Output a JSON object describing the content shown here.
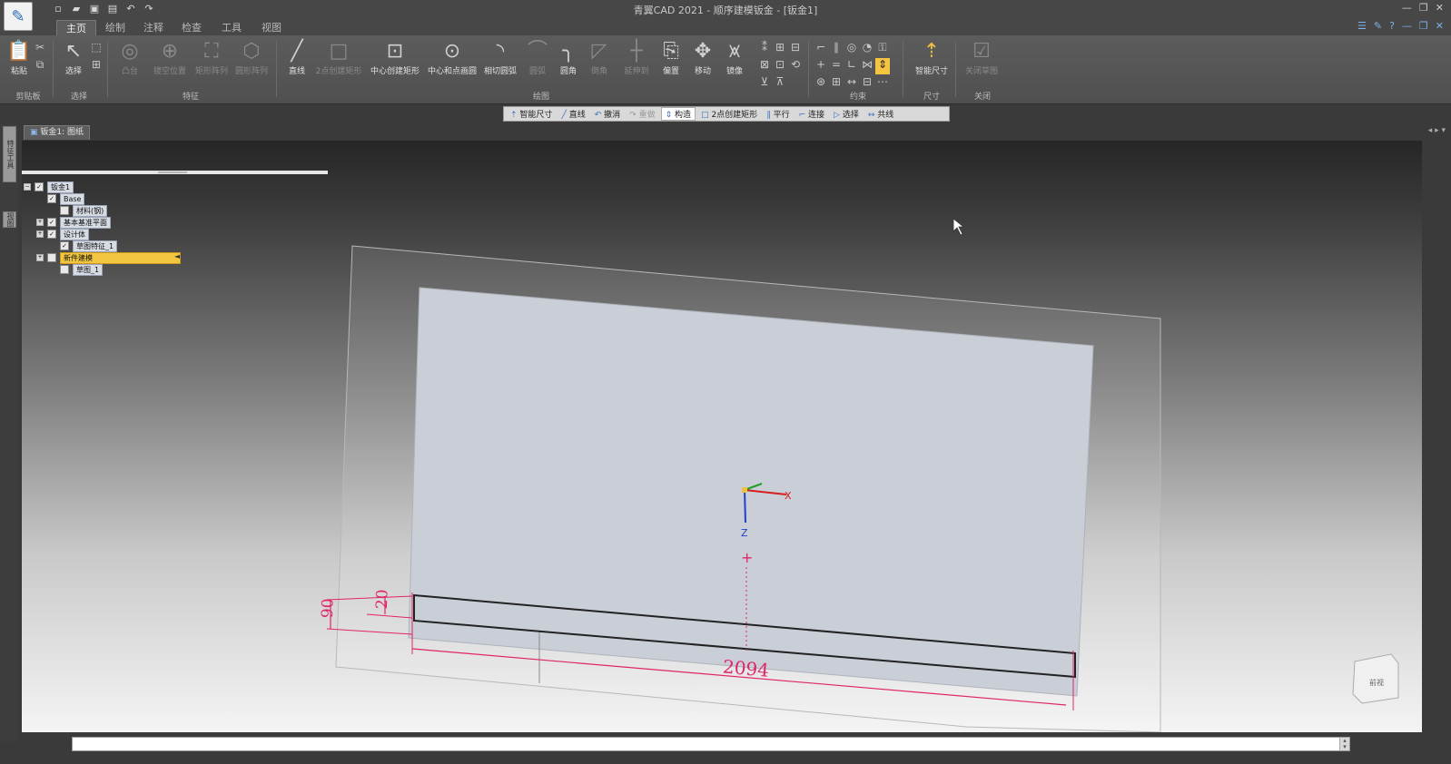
{
  "window": {
    "title": "青翼CAD 2021 - 顺序建模钣金 - [钣金1]",
    "logo_icon": "app-feather-logo"
  },
  "quick_access": [
    {
      "name": "new-icon",
      "glyph": "▫"
    },
    {
      "name": "open-icon",
      "glyph": "▰"
    },
    {
      "name": "save-icon",
      "glyph": "▣"
    },
    {
      "name": "print-icon",
      "glyph": "▤"
    },
    {
      "name": "undo-icon",
      "glyph": "↶"
    },
    {
      "name": "redo-icon",
      "glyph": "↷"
    }
  ],
  "ribbon_tabs": [
    "主页",
    "绘制",
    "注释",
    "检查",
    "工具",
    "视图"
  ],
  "active_tab": 0,
  "ribbon": {
    "paste": "粘贴",
    "select": "选择",
    "clipboard_group": "剪贴板",
    "select_group": "选择",
    "feature_group": "特征",
    "draw_group": "绘图",
    "constraint_group": "约束",
    "dimension_group": "尺寸",
    "close_group": "关闭",
    "feature_buttons": [
      "凸台",
      "镂空位置",
      "矩形阵列",
      "圆形阵列"
    ],
    "line": "直线",
    "rect_2pt": "2点创建矩形",
    "rect_center": "中心创建矩形",
    "circle_center": "中心和点画圆",
    "arc_tangent": "相切圆弧",
    "arc_3pt": "圆弧",
    "fillet": "圆角",
    "chamfer": "倒角",
    "trim_extend": "延伸到",
    "offset": "偏置",
    "move": "移动",
    "mirror": "镜像",
    "smart_dimension": "智能尺寸",
    "close_sketch": "关闭草图"
  },
  "command_bar": {
    "smart_dim": "智能尺寸",
    "line": "直线",
    "undo": "撤消",
    "redo": "重做",
    "construct": "构造",
    "rect2": "2点创建矩形",
    "parallel": "平行",
    "connect": "连接",
    "select": "选择",
    "collinear": "共线"
  },
  "document_tab": "钣金1: 图纸",
  "left_strip": [
    "特征工具",
    "视图"
  ],
  "tree": [
    {
      "label": "钣金1",
      "level": 0,
      "checked": true,
      "expander": "−"
    },
    {
      "label": "Base",
      "level": 1,
      "checked": true,
      "expander": ""
    },
    {
      "label": "材料(钢)",
      "level": 2,
      "checked": false,
      "expander": ""
    },
    {
      "label": "基本基准平面",
      "level": 1,
      "checked": true,
      "expander": "+"
    },
    {
      "label": "设计体",
      "level": 1,
      "checked": true,
      "expander": "+"
    },
    {
      "label": "草图特征_1",
      "level": 2,
      "checked": true,
      "expander": ""
    },
    {
      "label": "新件建模",
      "level": 1,
      "checked": false,
      "expander": "+",
      "selected": true,
      "suffix": "◄"
    },
    {
      "label": "草图_1",
      "level": 2,
      "checked": false,
      "expander": ""
    }
  ],
  "dimensions": {
    "overall_width": "2094",
    "height_outer": "90",
    "height_inner": "20"
  },
  "axes": {
    "x_label": "X",
    "z_label": "Z"
  },
  "view_cube_label": "前视",
  "colors": {
    "dimension": "#e0246a",
    "sketch_line": "#222222",
    "axis_x": "#d42020",
    "axis_y": "#20a020",
    "axis_z": "#2040d0",
    "selected_node": "#f2c640"
  }
}
